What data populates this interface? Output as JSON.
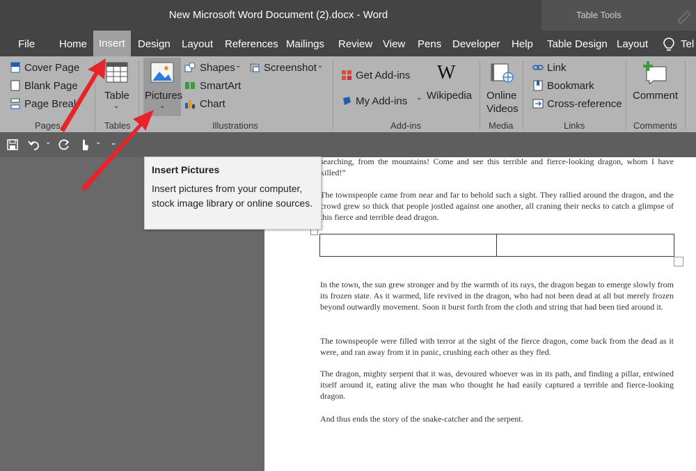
{
  "window": {
    "title": "New Microsoft Word Document (2).docx  -  Word",
    "context_tab_group": "Table Tools"
  },
  "tabs": [
    {
      "label": "File"
    },
    {
      "label": "Home"
    },
    {
      "label": "Insert"
    },
    {
      "label": "Design"
    },
    {
      "label": "Layout"
    },
    {
      "label": "References"
    },
    {
      "label": "Mailings"
    },
    {
      "label": "Review"
    },
    {
      "label": "View"
    },
    {
      "label": "Pens"
    },
    {
      "label": "Developer"
    },
    {
      "label": "Help"
    },
    {
      "label": "Table Design"
    },
    {
      "label": "Layout"
    },
    {
      "label": "Tel"
    }
  ],
  "active_tab": "Insert",
  "ribbon": {
    "pages": {
      "cover_page": "Cover Page",
      "blank_page": "Blank Page",
      "page_break": "Page Break",
      "group": "Pages"
    },
    "tables": {
      "table": "Table",
      "group": "Tables"
    },
    "illustrations": {
      "pictures": "Pictures",
      "shapes": "Shapes",
      "smartart": "SmartArt",
      "chart": "Chart",
      "screenshot": "Screenshot",
      "group": "Illustrations"
    },
    "addins": {
      "get_addins": "Get Add-ins",
      "my_addins": "My Add-ins",
      "wikipedia": "Wikipedia",
      "group": "Add-ins"
    },
    "media": {
      "online": "Online",
      "videos": "Videos",
      "group": "Media"
    },
    "links": {
      "link": "Link",
      "bookmark": "Bookmark",
      "cross_reference": "Cross-reference",
      "group": "Links"
    },
    "comments": {
      "comment": "Comment",
      "group": "Comments"
    }
  },
  "tooltip": {
    "title": "Insert Pictures",
    "body": "Insert pictures from your computer, stock image library or online sources."
  },
  "document": {
    "paragraphs": [
      "searching, from the mountains! Come and see this terrible and fierce-looking dragon, whom I have killed!”",
      "The townspeople came from near and far to behold such a sight. They rallied around the dragon, and the crowd grew so thick that people jostled against one another, all craning their necks to catch a glimpse of this fierce and terrible dead dragon.",
      "In the town, the sun grew stronger and by the warmth of its rays, the dragon began to emerge slowly from its frozen state. As it warmed, life revived in the dragon, who had not been dead at all but merely frozen beyond outwardly movement. Soon it burst forth from the cloth and string that had been tied around it.",
      "The townspeople were filled with terror at the sight of the fierce dragon, come back from the dead as it were, and ran away from it in panic, crushing each other as they fled.",
      "The dragon, mighty serpent that it was, devoured whoever was in its path, and finding a pillar, entwined itself around it, eating alive the man who thought he had easily captured a terrible and fierce-looking dragon.",
      "And thus ends the story of the snake-catcher and the serpent."
    ]
  },
  "colors": {
    "titlebar": "#444444",
    "ribbon": "#b4b4b4",
    "annotation_arrow": "#e8242a"
  },
  "icons": [
    "save-icon",
    "undo-icon",
    "redo-icon",
    "touch-mode-icon",
    "customize-qat-icon",
    "lightbulb-icon",
    "wikipedia-icon",
    "online-video-icon",
    "comment-icon",
    "link-icon",
    "bookmark-icon",
    "cross-reference-icon"
  ]
}
